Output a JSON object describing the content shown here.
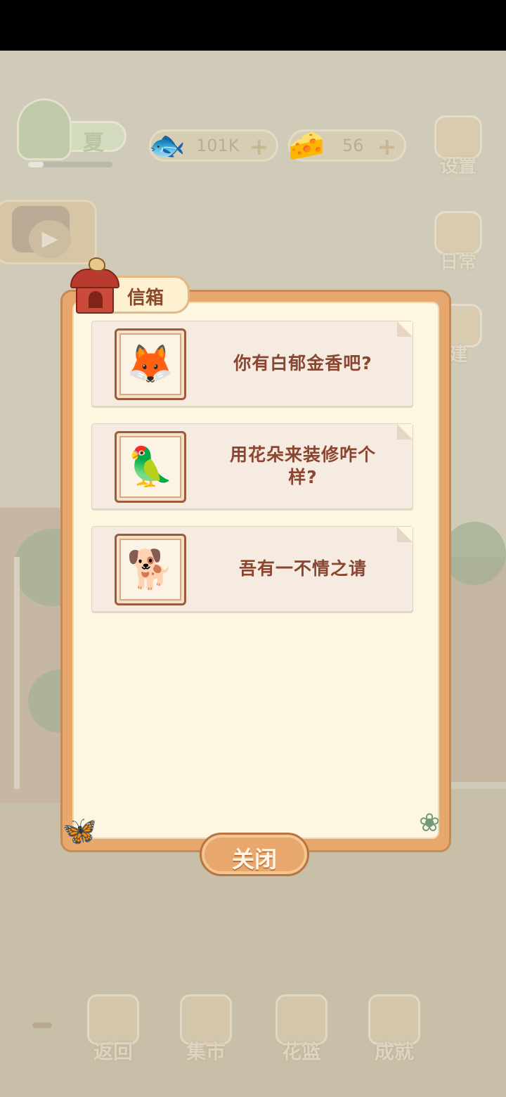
{
  "header": {
    "season": {
      "label": "夏",
      "progress": 0.18
    },
    "resources": [
      {
        "name": "fish",
        "icon": "fish-bone-icon",
        "value": "101K"
      },
      {
        "name": "cheese",
        "icon": "cheese-icon",
        "value": "56"
      }
    ],
    "settings_label": "设置"
  },
  "side_buttons": [
    {
      "label": "日常",
      "icon": "tips-paper-icon"
    },
    {
      "label": "建",
      "icon": "build-icon"
    }
  ],
  "dialog": {
    "title": "信箱",
    "letters": [
      {
        "sender": "white-fox",
        "avatar_icon": "fox-avatar-icon",
        "text_lines": [
          "你有白郁金香吧?"
        ]
      },
      {
        "sender": "hornbill",
        "avatar_icon": "bird-avatar-icon",
        "text_lines": [
          "用花朵来装修咋个",
          "样?"
        ]
      },
      {
        "sender": "shiba",
        "avatar_icon": "shiba-avatar-icon",
        "text_lines": [
          "吾有一不情之请"
        ]
      }
    ],
    "close_label": "关闭"
  },
  "bottom_nav": [
    {
      "label": "返回",
      "icon": "gate-icon"
    },
    {
      "label": "集市",
      "icon": "market-icon"
    },
    {
      "label": "花篮",
      "icon": "flower-basket-icon"
    },
    {
      "label": "成就",
      "icon": "trophy-icon"
    }
  ]
}
